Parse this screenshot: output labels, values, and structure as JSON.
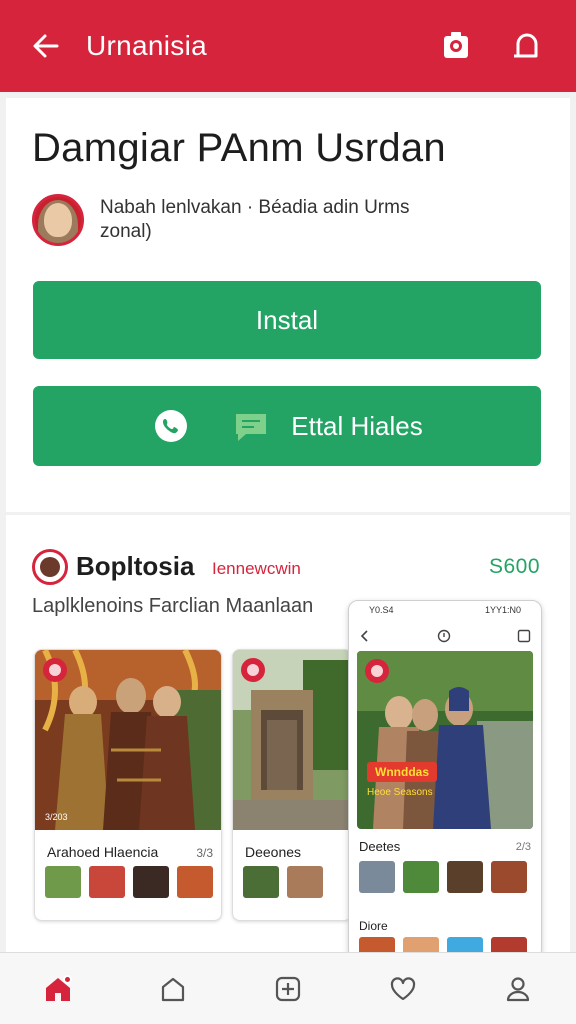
{
  "header": {
    "title": "Urnanisia",
    "back_icon": "arrow-left-icon",
    "actions": [
      "camera-icon",
      "chat-icon"
    ]
  },
  "product": {
    "title": "Damgiar PAnm Usrdan",
    "author_line": "Nabah lenlvakan · Béadia adin Urms zonal)",
    "install_label": "Instal",
    "share_label": "Ettal Hiales"
  },
  "listing": {
    "brand": "Bopltosia",
    "tag": "Iennewcwin",
    "price": "S600",
    "subtitle": "Laplklenoins Farclian Maanlaan",
    "screens": [
      {
        "caption": "Arahoed Hlaencia",
        "count": "3/3",
        "index_label": "3/203"
      },
      {
        "caption": "Deeones",
        "count": ""
      }
    ],
    "phone": {
      "status_left": "Y0.S4",
      "status_right": "1YY1:N0",
      "badge": "Wnnddas",
      "badge_sub": "Heoe Seasons",
      "caption": "Deetes",
      "caption_count": "2/3",
      "caption2": "Diore"
    }
  },
  "tabbar": {
    "items": [
      "home-icon",
      "explore-icon",
      "add-icon",
      "heart-icon",
      "profile-icon"
    ],
    "active": 0
  },
  "colors": {
    "brand_red": "#d6243c",
    "green": "#23a465"
  }
}
